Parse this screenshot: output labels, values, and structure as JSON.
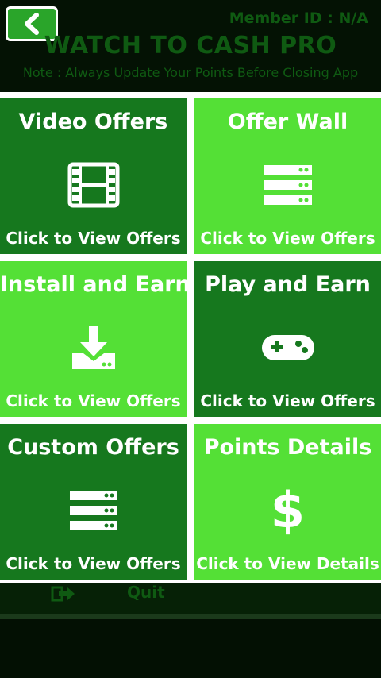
{
  "header": {
    "back_icon": "chevron-left-icon",
    "member_id": "Member ID : N/A",
    "title": "WATCH TO CASH PRO",
    "note": "Note : Always Update Your Points Before Closing App"
  },
  "tiles": [
    {
      "title": "Video Offers",
      "subtitle": "Click to View Offers",
      "icon": "film-icon",
      "color": "#16781e"
    },
    {
      "title": "Offer Wall",
      "subtitle": "Click to View Offers",
      "icon": "server-list-icon",
      "color": "#54e036"
    },
    {
      "title": "Install and Earn",
      "subtitle": "Click to View Offers",
      "icon": "download-icon",
      "color": "#54e036"
    },
    {
      "title": "Play and Earn",
      "subtitle": "Click to View Offers",
      "icon": "gamepad-icon",
      "color": "#16781e"
    },
    {
      "title": "Custom Offers",
      "subtitle": "Click to View Offers",
      "icon": "server-list-icon",
      "color": "#16781e"
    },
    {
      "title": "Points Details",
      "subtitle": "Click to View Details",
      "icon": "dollar-icon",
      "symbol": "$",
      "color": "#54e036"
    }
  ],
  "footer": {
    "quit_label": "Quit",
    "quit_icon": "exit-icon"
  }
}
